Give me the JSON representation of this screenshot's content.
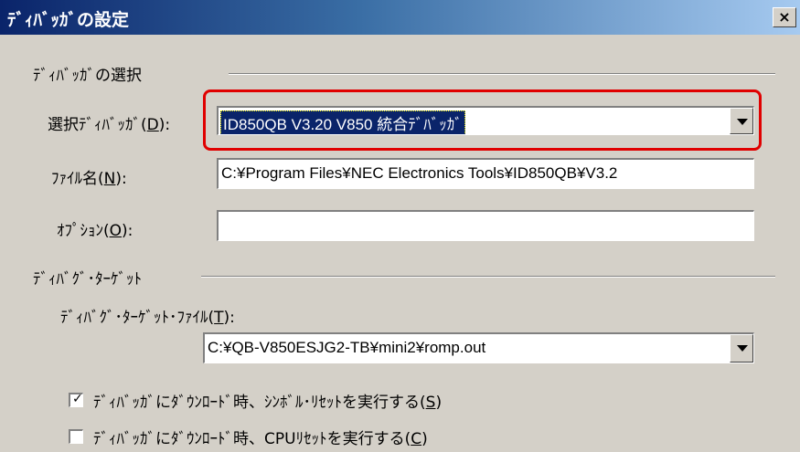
{
  "window": {
    "title": "ﾃﾞｨﾊﾞｯｶﾞの設定",
    "close_glyph": "×"
  },
  "debugger_group": {
    "heading": "ﾃﾞｨﾊﾞｯｶﾞの選択",
    "select_label_pre": "選択ﾃﾞｨﾊﾞｯｶﾞ(",
    "select_label_key": "D",
    "select_label_post": "):",
    "select_value": "ID850QB V3.20 V850 統合ﾃﾞﾊﾞｯｶﾞ",
    "file_label_pre": "ﾌｧｲﾙ名(",
    "file_label_key": "N",
    "file_label_post": "):",
    "file_value": "C:¥Program Files¥NEC Electronics Tools¥ID850QB¥V3.2",
    "option_label_pre": "ｵﾌﾟｼｮﾝ(",
    "option_label_key": "O",
    "option_label_post": "):",
    "option_value": ""
  },
  "target_group": {
    "heading": "ﾃﾞｨﾊﾞｸﾞ･ﾀｰｹﾞｯﾄ",
    "file_label_pre": "ﾃﾞｨﾊﾞｸﾞ･ﾀｰｹﾞｯﾄ･ﾌｧｲﾙ(",
    "file_label_key": "T",
    "file_label_post": "):",
    "file_value": "C:¥QB-V850ESJG2-TB¥mini2¥romp.out"
  },
  "checkboxes": [
    {
      "pre": "ﾃﾞｨﾊﾞｯｶﾞにﾀﾞｳﾝﾛｰﾄﾞ時、ｼﾝﾎﾞﾙ･ﾘｾｯﾄを実行する(",
      "key": "S",
      "post": ")",
      "checked": true,
      "mark": "✓"
    },
    {
      "pre": "ﾃﾞｨﾊﾞｯｶﾞにﾀﾞｳﾝﾛｰﾄﾞ時、CPUﾘｾｯﾄを実行する(",
      "key": "C",
      "post": ")",
      "checked": false,
      "mark": ""
    }
  ],
  "colors": {
    "highlight": "#e00000",
    "selection": "#0a246a"
  }
}
